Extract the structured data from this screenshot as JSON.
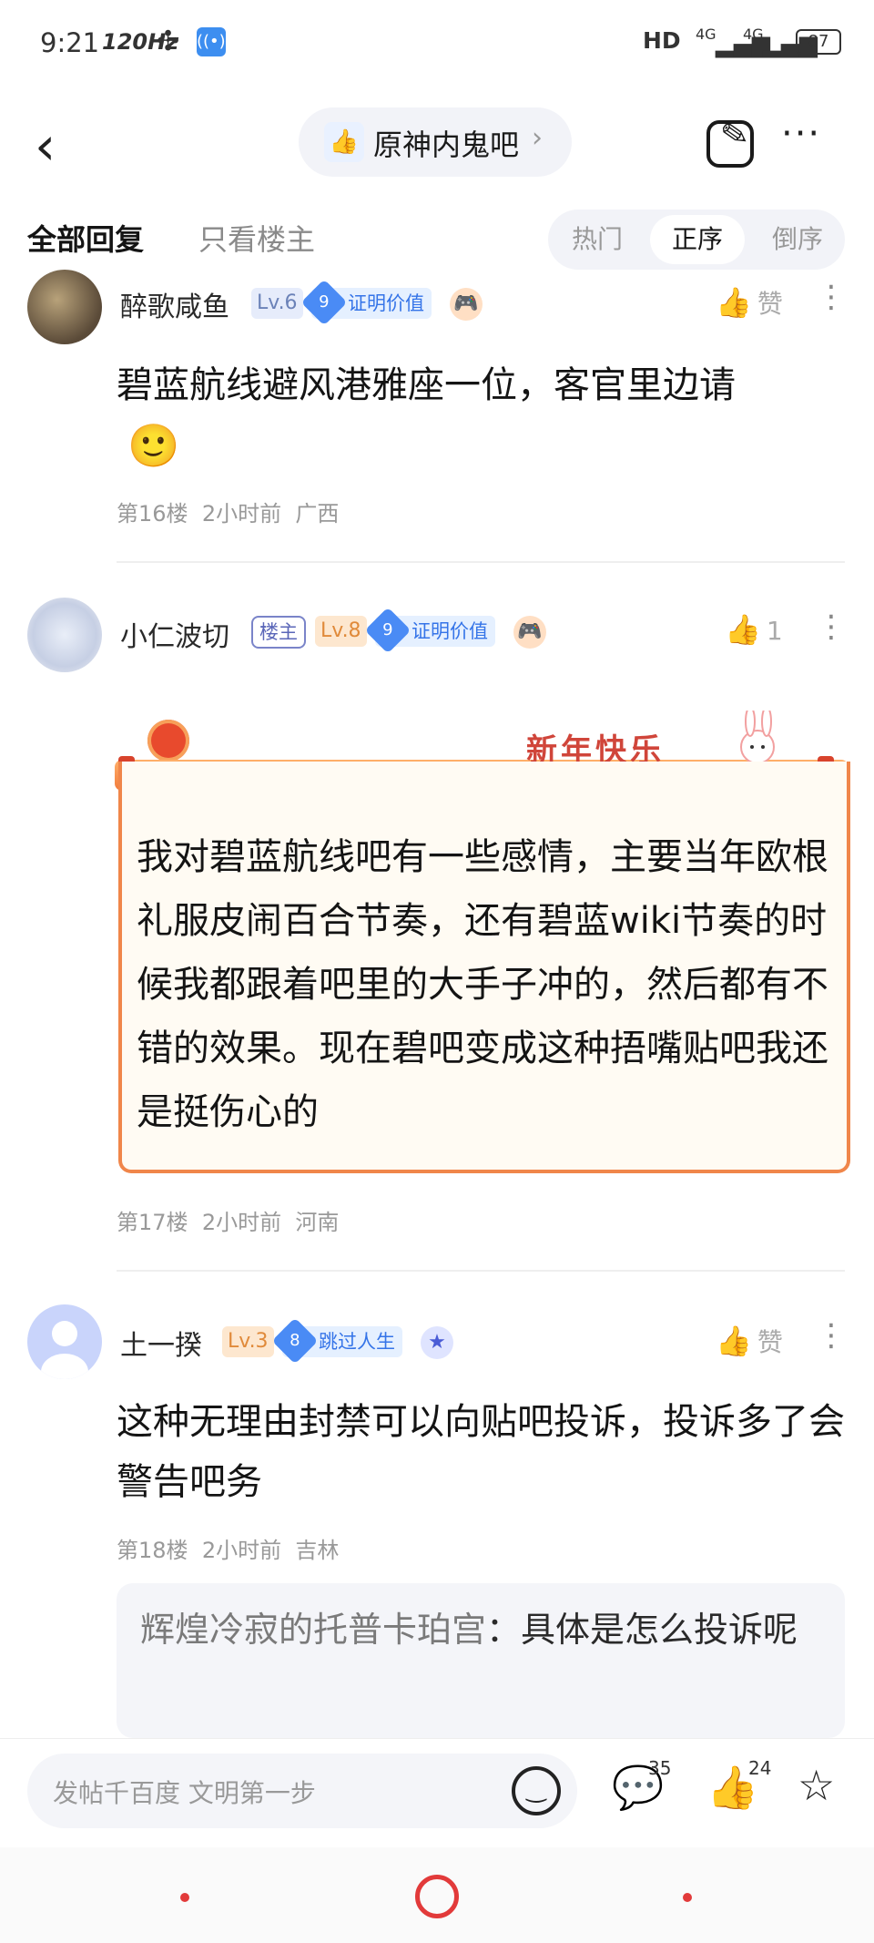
{
  "status": {
    "time": "9:21",
    "refresh": "120Hz",
    "network": "HD",
    "sim1": "4G",
    "sim2": "4G",
    "battery": "87"
  },
  "nav": {
    "forum_name": "原神内鬼吧",
    "logo_text": "有赞"
  },
  "tabs": {
    "all": "全部回复",
    "owner_only": "只看楼主",
    "sort": [
      "热门",
      "正序",
      "倒序"
    ],
    "active_sort": "正序"
  },
  "posts": [
    {
      "user": "醉歌咸鱼",
      "level": "Lv.6",
      "honor_level": "9",
      "honor": "证明价值",
      "likes": "赞",
      "content": "碧蓝航线避风港雅座一位，客官里边请",
      "emoji": "🙂",
      "floor": "第16楼",
      "time": "2小时前",
      "location": "广西"
    },
    {
      "user": "小仁波切",
      "owner_tag": "楼主",
      "level": "Lv.8",
      "honor_level": "9",
      "honor": "证明价值",
      "likes": "1",
      "card_title": "新年快乐",
      "content": "我对碧蓝航线吧有一些感情，主要当年欧根礼服皮闹百合节奏，还有碧蓝wiki节奏的时候我都跟着吧里的大手子冲的，然后都有不错的效果。现在碧吧变成这种捂嘴贴吧我还是挺伤心的",
      "floor": "第17楼",
      "time": "2小时前",
      "location": "河南"
    },
    {
      "user": "土一揆",
      "level": "Lv.3",
      "honor_level": "8",
      "honor": "跳过人生",
      "likes": "赞",
      "content": "这种无理由封禁可以向贴吧投诉，投诉多了会警告吧务",
      "floor": "第18楼",
      "time": "2小时前",
      "location": "吉林",
      "reply": {
        "author": "辉煌冷寂的托普卡珀宫",
        "sep": "：",
        "text": "具体是怎么投诉呢"
      }
    }
  ],
  "bottom": {
    "placeholder": "发帖千百度 文明第一步",
    "comments": "35",
    "likes": "24"
  }
}
